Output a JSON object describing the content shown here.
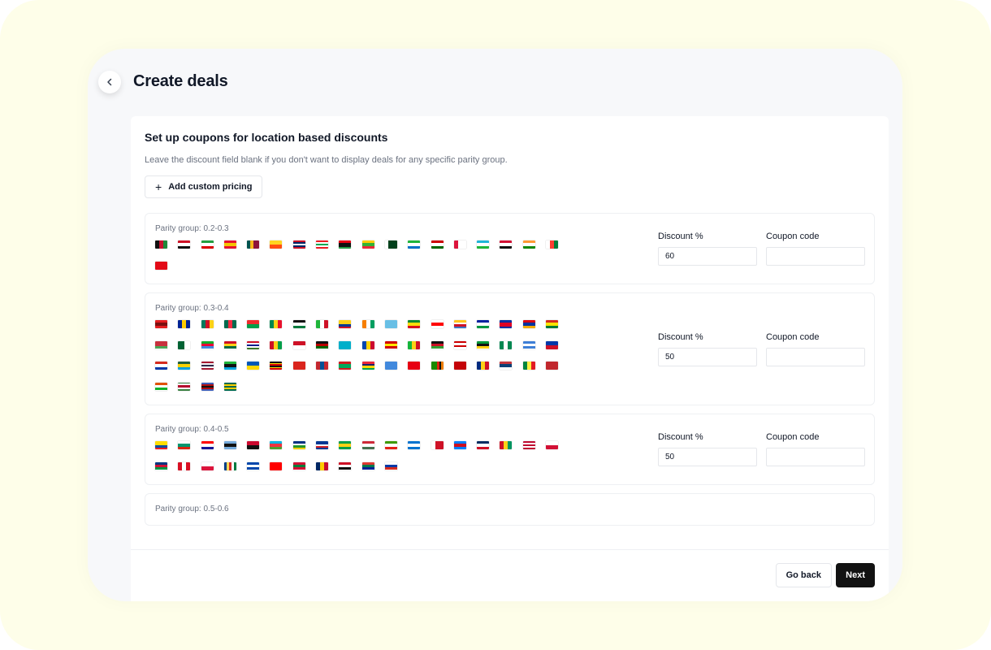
{
  "header": {
    "title": "Create deals",
    "back_icon": "chevron-left-icon"
  },
  "card": {
    "title": "Set up coupons for location based discounts",
    "subtitle": "Leave the discount field blank if you don't want to display deals for any specific parity group.",
    "add_button_icon": "+",
    "add_button_label": "Add custom pricing"
  },
  "field_labels": {
    "discount": "Discount %",
    "coupon": "Coupon code"
  },
  "groups": [
    {
      "label": "Parity group: 0.2-0.3",
      "discount": "60",
      "coupon": "",
      "countries": [
        "Afghanistan",
        "Egypt",
        "Iran",
        "Kyrgyzstan",
        "Sri Lanka",
        "Bhutan",
        "Laos",
        "Lebanon",
        "Libya",
        "Myanmar",
        "Pakistan",
        "Sierra Leone",
        "Tajikistan",
        "Nepal",
        "Uzbekistan",
        "Sudan",
        "India",
        "Madagascar",
        "Turkey"
      ]
    },
    {
      "label": "Parity group: 0.3-0.4",
      "discount": "50",
      "coupon": "",
      "countries": [
        "Albania",
        "Bosnia and Herzegovina",
        "Cameroon",
        "Bangladesh",
        "Burkina Faso",
        "Benin",
        "Jordan",
        "Burundi",
        "Colombia",
        "Côte d'Ivoire",
        "Fiji",
        "Ethiopia",
        "Georgia",
        "Comoros",
        "Lesotho",
        "Cambodia",
        "Armenia",
        "Bolivia",
        "Belarus",
        "Algeria",
        "Eritrea",
        "Ghana",
        "Gambia",
        "Guinea-Bissau",
        "Indonesia",
        "Kenya",
        "Kazakhstan",
        "Moldova",
        "North Macedonia",
        "Mali",
        "Malawi",
        "Malaysia",
        "Mozambique",
        "Nigeria",
        "Nicaragua",
        "Philippines",
        "Paraguay",
        "Rwanda",
        "Thailand",
        "Tanzania",
        "Ukraine",
        "Uganda",
        "Vietnam",
        "Mongolia",
        "Mauritania",
        "Mauritius",
        "Somalia",
        "Tunisia",
        "Zambia",
        "Montenegro",
        "Romania",
        "Serbia",
        "Senegal",
        "Morocco",
        "Niger",
        "Suriname",
        "Eswatini",
        "Togo"
      ]
    },
    {
      "label": "Parity group: 0.4-0.5",
      "discount": "50",
      "coupon": "",
      "countries": [
        "Ecuador",
        "Bulgaria",
        "Croatia",
        "Botswana",
        "Angola",
        "Azerbaijan",
        "Central African Republic",
        "Cape Verde",
        "Guyana",
        "Hungary",
        "Equatorial Guinea",
        "Honduras",
        "Bahrain",
        "DR Congo",
        "Dominican Republic",
        "Guinea",
        "Liberia",
        "Panama",
        "Namibia",
        "Peru",
        "Poland",
        "Seychelles",
        "El Salvador",
        "Taiwan",
        "Maldives",
        "Chad",
        "Yemen",
        "South Africa",
        "Russia"
      ]
    },
    {
      "label": "Parity group: 0.5-0.6",
      "discount": "",
      "coupon": "",
      "countries": []
    }
  ],
  "flag_colors": {
    "Afghanistan": {
      "d": "v",
      "c": [
        "#111111",
        "#c8102e",
        "#1f8a3b"
      ]
    },
    "Egypt": {
      "d": "h",
      "c": [
        "#ce1126",
        "#ffffff",
        "#111111"
      ]
    },
    "Iran": {
      "d": "h",
      "c": [
        "#239f40",
        "#ffffff",
        "#da0000"
      ]
    },
    "Kyrgyzstan": {
      "d": "h",
      "c": [
        "#e8112d",
        "#f4c400",
        "#e8112d"
      ]
    },
    "Sri Lanka": {
      "d": "v",
      "c": [
        "#00534e",
        "#f7b718",
        "#8d153a",
        "#8d153a"
      ]
    },
    "Bhutan": {
      "d": "h",
      "c": [
        "#ffd520",
        "#ff4e12"
      ]
    },
    "Laos": {
      "d": "h",
      "c": [
        "#ce1126",
        "#002868",
        "#ffffff",
        "#002868",
        "#ce1126"
      ]
    },
    "Lebanon": {
      "d": "h",
      "c": [
        "#ed1c24",
        "#ffffff",
        "#00a651",
        "#ffffff",
        "#ed1c24"
      ]
    },
    "Libya": {
      "d": "h",
      "c": [
        "#e70013",
        "#111111",
        "#111111",
        "#239e46"
      ]
    },
    "Myanmar": {
      "d": "h",
      "c": [
        "#fecb00",
        "#34b233",
        "#ea2839"
      ]
    },
    "Pakistan": {
      "d": "v",
      "c": [
        "#ffffff",
        "#01411c",
        "#01411c",
        "#01411c"
      ]
    },
    "Sierra Leone": {
      "d": "h",
      "c": [
        "#1eb53a",
        "#ffffff",
        "#0072c6"
      ]
    },
    "Tajikistan": {
      "d": "h",
      "c": [
        "#cc0000",
        "#ffffff",
        "#006600"
      ]
    },
    "Nepal": {
      "d": "v",
      "c": [
        "#dc143c",
        "#ffffff",
        "#ffffff"
      ]
    },
    "Uzbekistan": {
      "d": "h",
      "c": [
        "#1eb5d8",
        "#ffffff",
        "#1eb53a"
      ]
    },
    "Sudan": {
      "d": "h",
      "c": [
        "#d21034",
        "#ffffff",
        "#111111"
      ]
    },
    "India": {
      "d": "h",
      "c": [
        "#ff9933",
        "#ffffff",
        "#138808"
      ]
    },
    "Madagascar": {
      "d": "v",
      "c": [
        "#ffffff",
        "#fc3d32",
        "#007e3a"
      ]
    },
    "Turkey": {
      "d": "h",
      "c": [
        "#e30a17",
        "#e30a17"
      ]
    },
    "Albania": {
      "d": "h",
      "c": [
        "#e41e20",
        "#7a1010",
        "#e41e20"
      ]
    },
    "Bosnia and Herzegovina": {
      "d": "v",
      "c": [
        "#002395",
        "#fecb00",
        "#002395"
      ]
    },
    "Cameroon": {
      "d": "v",
      "c": [
        "#007a5e",
        "#ce1126",
        "#fcd116"
      ]
    },
    "Bangladesh": {
      "d": "v",
      "c": [
        "#006a4e",
        "#f42a41",
        "#006a4e"
      ]
    },
    "Burkina Faso": {
      "d": "h",
      "c": [
        "#ef2b2d",
        "#009e49"
      ]
    },
    "Benin": {
      "d": "v",
      "c": [
        "#008751",
        "#fcd116",
        "#e8112d"
      ]
    },
    "Jordan": {
      "d": "h",
      "c": [
        "#111111",
        "#ffffff",
        "#007a3d"
      ]
    },
    "Burundi": {
      "d": "v",
      "c": [
        "#1eb53a",
        "#ffffff",
        "#ce1126"
      ]
    },
    "Colombia": {
      "d": "h",
      "c": [
        "#fcd116",
        "#fcd116",
        "#003893",
        "#ce1126"
      ]
    },
    "Côte d'Ivoire": {
      "d": "v",
      "c": [
        "#f77f00",
        "#ffffff",
        "#009e60"
      ]
    },
    "Fiji": {
      "d": "h",
      "c": [
        "#68bfe5",
        "#68bfe5"
      ]
    },
    "Ethiopia": {
      "d": "h",
      "c": [
        "#078930",
        "#fcdd09",
        "#da121a"
      ]
    },
    "Georgia": {
      "d": "h",
      "c": [
        "#ffffff",
        "#ff0000",
        "#ffffff"
      ]
    },
    "Comoros": {
      "d": "h",
      "c": [
        "#ffc61e",
        "#ffffff",
        "#ce1126",
        "#3a75c4"
      ]
    },
    "Lesotho": {
      "d": "h",
      "c": [
        "#00209f",
        "#ffffff",
        "#009543"
      ]
    },
    "Cambodia": {
      "d": "h",
      "c": [
        "#032ea1",
        "#e00025",
        "#e00025",
        "#032ea1"
      ]
    },
    "Armenia": {
      "d": "h",
      "c": [
        "#d90012",
        "#0033a0",
        "#f2a800"
      ]
    },
    "Bolivia": {
      "d": "h",
      "c": [
        "#d52b1e",
        "#f9e300",
        "#007934"
      ]
    },
    "Belarus": {
      "d": "h",
      "c": [
        "#c8313e",
        "#c8313e",
        "#4aa657"
      ]
    },
    "Algeria": {
      "d": "v",
      "c": [
        "#006233",
        "#ffffff"
      ]
    },
    "Eritrea": {
      "d": "h",
      "c": [
        "#12ad2b",
        "#ea0437",
        "#4189dd"
      ]
    },
    "Ghana": {
      "d": "h",
      "c": [
        "#ce1126",
        "#fcd116",
        "#006b3f"
      ]
    },
    "Gambia": {
      "d": "h",
      "c": [
        "#ce1126",
        "#ffffff",
        "#0c1c8c",
        "#ffffff",
        "#3a7728"
      ]
    },
    "Guinea-Bissau": {
      "d": "v",
      "c": [
        "#ce1126",
        "#fcd116",
        "#009e49"
      ]
    },
    "Indonesia": {
      "d": "h",
      "c": [
        "#ce1126",
        "#ffffff"
      ]
    },
    "Kenya": {
      "d": "h",
      "c": [
        "#111111",
        "#bb0000",
        "#006600"
      ]
    },
    "Kazakhstan": {
      "d": "h",
      "c": [
        "#00afca",
        "#00afca"
      ]
    },
    "Moldova": {
      "d": "v",
      "c": [
        "#0046ae",
        "#ffd200",
        "#cc092f"
      ]
    },
    "North Macedonia": {
      "d": "h",
      "c": [
        "#d20000",
        "#ffe600",
        "#d20000"
      ]
    },
    "Mali": {
      "d": "v",
      "c": [
        "#14b53a",
        "#fcd116",
        "#ce1126"
      ]
    },
    "Malawi": {
      "d": "h",
      "c": [
        "#111111",
        "#ce1126",
        "#339e35"
      ]
    },
    "Malaysia": {
      "d": "h",
      "c": [
        "#cc0001",
        "#ffffff",
        "#cc0001",
        "#ffffff"
      ]
    },
    "Mozambique": {
      "d": "h",
      "c": [
        "#009739",
        "#111111",
        "#fcd116"
      ]
    },
    "Nigeria": {
      "d": "v",
      "c": [
        "#008751",
        "#ffffff",
        "#008751"
      ]
    },
    "Nicaragua": {
      "d": "h",
      "c": [
        "#3e7fd6",
        "#ffffff",
        "#3e7fd6"
      ]
    },
    "Philippines": {
      "d": "h",
      "c": [
        "#0038a8",
        "#ce1126"
      ]
    },
    "Paraguay": {
      "d": "h",
      "c": [
        "#d52b1e",
        "#ffffff",
        "#0038a8"
      ]
    },
    "Rwanda": {
      "d": "h",
      "c": [
        "#20603d",
        "#fad201",
        "#00a1de"
      ]
    },
    "Thailand": {
      "d": "h",
      "c": [
        "#a51931",
        "#f4f5f8",
        "#2d2a4a",
        "#f4f5f8",
        "#a51931"
      ]
    },
    "Tanzania": {
      "d": "h",
      "c": [
        "#1eb53a",
        "#111111",
        "#00a3dd"
      ]
    },
    "Ukraine": {
      "d": "h",
      "c": [
        "#0057b7",
        "#ffd700"
      ]
    },
    "Uganda": {
      "d": "h",
      "c": [
        "#111111",
        "#fcdc04",
        "#d90000",
        "#111111",
        "#fcdc04",
        "#d90000"
      ]
    },
    "Vietnam": {
      "d": "h",
      "c": [
        "#da251d",
        "#da251d"
      ]
    },
    "Mongolia": {
      "d": "v",
      "c": [
        "#c4272f",
        "#015197",
        "#c4272f"
      ]
    },
    "Mauritania": {
      "d": "h",
      "c": [
        "#d01c1f",
        "#00a95c",
        "#00a95c",
        "#d01c1f"
      ]
    },
    "Mauritius": {
      "d": "h",
      "c": [
        "#ea2839",
        "#1a206d",
        "#ffd500",
        "#00a551"
      ]
    },
    "Somalia": {
      "d": "h",
      "c": [
        "#4189dd",
        "#4189dd"
      ]
    },
    "Tunisia": {
      "d": "h",
      "c": [
        "#e70013",
        "#e70013"
      ]
    },
    "Zambia": {
      "d": "v",
      "c": [
        "#198a00",
        "#198a00",
        "#198a00",
        "#de2010",
        "#111111",
        "#ef7d00"
      ]
    },
    "Montenegro": {
      "d": "h",
      "c": [
        "#c40308",
        "#c40308"
      ]
    },
    "Romania": {
      "d": "v",
      "c": [
        "#002b7f",
        "#fcd116",
        "#ce1126"
      ]
    },
    "Serbia": {
      "d": "h",
      "c": [
        "#c6363c",
        "#0c4076",
        "#ffffff"
      ]
    },
    "Senegal": {
      "d": "v",
      "c": [
        "#00853f",
        "#fdef42",
        "#e31b23"
      ]
    },
    "Morocco": {
      "d": "h",
      "c": [
        "#c1272d",
        "#c1272d"
      ]
    },
    "Niger": {
      "d": "h",
      "c": [
        "#e05206",
        "#ffffff",
        "#0db02b"
      ]
    },
    "Suriname": {
      "d": "h",
      "c": [
        "#377e3f",
        "#ffffff",
        "#b40a2d",
        "#b40a2d",
        "#ffffff",
        "#377e3f"
      ]
    },
    "Eswatini": {
      "d": "h",
      "c": [
        "#3e5eb9",
        "#b10c0c",
        "#111111",
        "#b10c0c",
        "#3e5eb9"
      ]
    },
    "Togo": {
      "d": "h",
      "c": [
        "#006a4e",
        "#ffce00",
        "#006a4e",
        "#ffce00",
        "#006a4e"
      ]
    },
    "Ecuador": {
      "d": "h",
      "c": [
        "#ffdd00",
        "#ffdd00",
        "#034ea2",
        "#ed1c24"
      ]
    },
    "Bulgaria": {
      "d": "h",
      "c": [
        "#ffffff",
        "#00966e",
        "#d62612"
      ]
    },
    "Croatia": {
      "d": "h",
      "c": [
        "#ff0000",
        "#ffffff",
        "#171796"
      ]
    },
    "Botswana": {
      "d": "h",
      "c": [
        "#75aadb",
        "#111111",
        "#75aadb"
      ]
    },
    "Angola": {
      "d": "h",
      "c": [
        "#cc092f",
        "#111111"
      ]
    },
    "Azerbaijan": {
      "d": "h",
      "c": [
        "#00b5e2",
        "#ef3340",
        "#509e2f"
      ]
    },
    "Central African Republic": {
      "d": "h",
      "c": [
        "#003082",
        "#ffffff",
        "#289728",
        "#ffce00"
      ]
    },
    "Cape Verde": {
      "d": "h",
      "c": [
        "#003893",
        "#003893",
        "#ffffff",
        "#cf2027",
        "#003893"
      ]
    },
    "Guyana": {
      "d": "h",
      "c": [
        "#009e49",
        "#fcd116",
        "#009e49"
      ]
    },
    "Hungary": {
      "d": "h",
      "c": [
        "#ce2939",
        "#ffffff",
        "#477050"
      ]
    },
    "Equatorial Guinea": {
      "d": "h",
      "c": [
        "#3e9a00",
        "#ffffff",
        "#e32118"
      ]
    },
    "Honduras": {
      "d": "h",
      "c": [
        "#0073cf",
        "#ffffff",
        "#0073cf"
      ]
    },
    "Bahrain": {
      "d": "v",
      "c": [
        "#ffffff",
        "#ce1126",
        "#ce1126"
      ]
    },
    "DR Congo": {
      "d": "h",
      "c": [
        "#007fff",
        "#ce1021",
        "#007fff"
      ]
    },
    "Dominican Republic": {
      "d": "h",
      "c": [
        "#002d62",
        "#ffffff",
        "#ce1126"
      ]
    },
    "Guinea": {
      "d": "v",
      "c": [
        "#ce1126",
        "#fcd116",
        "#009460"
      ]
    },
    "Liberia": {
      "d": "h",
      "c": [
        "#bf0a30",
        "#ffffff",
        "#bf0a30",
        "#ffffff",
        "#bf0a30"
      ]
    },
    "Panama": {
      "d": "h",
      "c": [
        "#ffffff",
        "#d21034"
      ]
    },
    "Namibia": {
      "d": "h",
      "c": [
        "#003580",
        "#d21034",
        "#009543"
      ]
    },
    "Peru": {
      "d": "v",
      "c": [
        "#d91023",
        "#ffffff",
        "#d91023"
      ]
    },
    "Poland": {
      "d": "h",
      "c": [
        "#ffffff",
        "#dc143c"
      ]
    },
    "Seychelles": {
      "d": "v",
      "c": [
        "#003f87",
        "#fcd856",
        "#d62828",
        "#ffffff",
        "#007a3d"
      ]
    },
    "El Salvador": {
      "d": "h",
      "c": [
        "#0047ab",
        "#ffffff",
        "#0047ab"
      ]
    },
    "Taiwan": {
      "d": "h",
      "c": [
        "#fe0000",
        "#fe0000"
      ]
    },
    "Maldives": {
      "d": "h",
      "c": [
        "#d21034",
        "#007e3a",
        "#d21034"
      ]
    },
    "Chad": {
      "d": "v",
      "c": [
        "#002664",
        "#fecb00",
        "#c60c30"
      ]
    },
    "Yemen": {
      "d": "h",
      "c": [
        "#ce1126",
        "#ffffff",
        "#111111"
      ]
    },
    "South Africa": {
      "d": "h",
      "c": [
        "#de3831",
        "#007a4d",
        "#002395"
      ]
    },
    "Russia": {
      "d": "h",
      "c": [
        "#ffffff",
        "#0039a6",
        "#d52b1e"
      ]
    }
  },
  "footer": {
    "back_label": "Go back",
    "next_label": "Next"
  },
  "colors": {
    "accent": "#121212",
    "muted_text": "#6b7280",
    "page_bg": "#fefee9",
    "window_bg": "#f7f8fa"
  }
}
